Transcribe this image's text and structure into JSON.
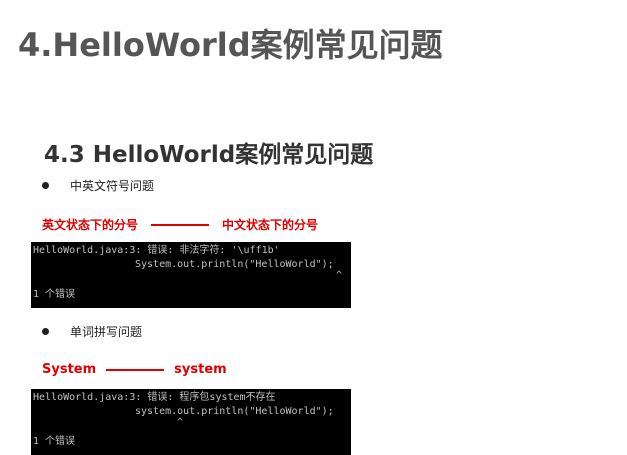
{
  "page_title": "4.HelloWorld案例常见问题",
  "section_title": "4.3 HelloWorld案例常见问题",
  "items": [
    {
      "bullet": "中英文符号问题",
      "left_label": "英文状态下的分号",
      "right_label": "中文状态下的分号",
      "console": {
        "line1": "HelloWorld.java:3: 错误: 非法字符: '\\uff1b'",
        "line2": "System.out.println(\"HelloWorld\");",
        "caret": "^",
        "line3": "1 个错误"
      }
    },
    {
      "bullet": "单词拼写问题",
      "left_label": "System",
      "right_label": "system",
      "console": {
        "line1": "HelloWorld.java:3: 错误: 程序包system不存在",
        "line2": "system.out.println(\"HelloWorld\");",
        "caret": "^",
        "line3": "1 个错误"
      }
    }
  ],
  "colors": {
    "title": "#555555",
    "accent_red": "#e00000",
    "console_bg": "#000000",
    "console_text": "#c0c0c0"
  }
}
